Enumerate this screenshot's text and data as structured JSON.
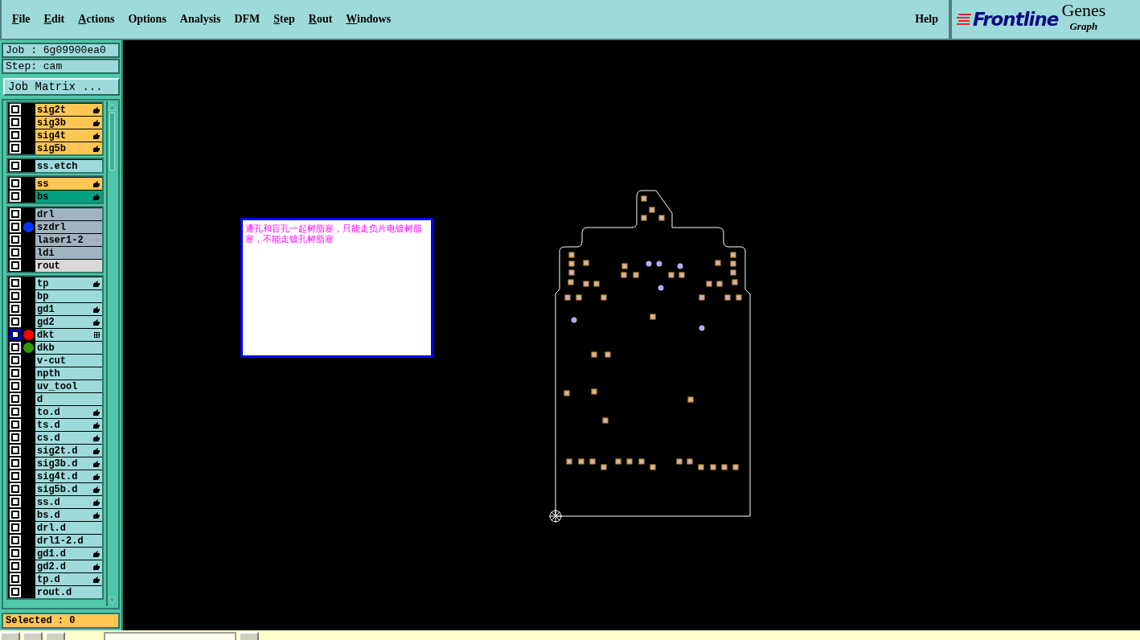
{
  "menu_bar": {
    "items": [
      {
        "label": "File",
        "underlined": true
      },
      {
        "label": "Edit",
        "underlined": true
      },
      {
        "label": "Actions",
        "underlined": true
      },
      {
        "label": "Options",
        "underlined": false
      },
      {
        "label": "Analysis",
        "underlined": false
      },
      {
        "label": "DFM",
        "underlined": false
      },
      {
        "label": "Step",
        "underlined": true
      },
      {
        "label": "Rout",
        "underlined": true
      },
      {
        "label": "Windows",
        "underlined": true
      }
    ],
    "help": "Help"
  },
  "logo": {
    "brand": "Frontline",
    "product": "Genes",
    "subtitle": "Graph"
  },
  "job_panel": {
    "job": "Job : 6g09900ea0",
    "step": "Step: cam",
    "job_matrix_button": "Job Matrix ...",
    "layer_groups": [
      [
        {
          "name": "sig2t",
          "kind": "signal",
          "modified": true,
          "focused": false
        },
        {
          "name": "sig3b",
          "kind": "signal",
          "modified": true,
          "focused": false
        },
        {
          "name": "sig4t",
          "kind": "signal",
          "modified": true,
          "focused": false
        },
        {
          "name": "sig5b",
          "kind": "signal",
          "modified": true,
          "focused": false
        }
      ],
      [
        {
          "name": "ss.etch",
          "kind": "document",
          "modified": false,
          "focused": false
        }
      ],
      [
        {
          "name": "ss",
          "kind": "signal",
          "modified": true,
          "focused": false
        },
        {
          "name": "bs",
          "kind": "solder",
          "modified": true,
          "focused": false
        }
      ],
      [
        {
          "name": "drl",
          "kind": "drill",
          "modified": false,
          "focused": false
        },
        {
          "name": "szdrl",
          "kind": "drill",
          "color": "#0033ff",
          "modified": false,
          "focused": false
        },
        {
          "name": "laser1-2",
          "kind": "drill",
          "modified": false,
          "focused": false
        },
        {
          "name": "ldi",
          "kind": "drill",
          "modified": false,
          "focused": false
        },
        {
          "name": "rout",
          "kind": "rout",
          "modified": false,
          "focused": false
        }
      ],
      [
        {
          "name": "tp",
          "kind": "document",
          "modified": true,
          "focused": false
        },
        {
          "name": "bp",
          "kind": "document",
          "modified": false,
          "focused": false
        },
        {
          "name": "gd1",
          "kind": "document",
          "modified": true,
          "focused": false
        },
        {
          "name": "gd2",
          "kind": "document",
          "modified": true,
          "focused": false
        },
        {
          "name": "dkt",
          "kind": "document",
          "modified": false,
          "expandable": true,
          "color": "#ff0000",
          "focused": true
        },
        {
          "name": "dkb",
          "kind": "document",
          "color": "#339900",
          "modified": false,
          "focused": false
        },
        {
          "name": "v-cut",
          "kind": "document",
          "modified": false,
          "focused": false
        },
        {
          "name": "npth",
          "kind": "document",
          "modified": false,
          "focused": false
        },
        {
          "name": "uv_tool",
          "kind": "document",
          "modified": false,
          "focused": false
        },
        {
          "name": "d",
          "kind": "document",
          "modified": false,
          "focused": false
        },
        {
          "name": "to.d",
          "kind": "document",
          "modified": true,
          "focused": false
        },
        {
          "name": "ts.d",
          "kind": "document",
          "modified": true,
          "focused": false
        },
        {
          "name": "cs.d",
          "kind": "document",
          "modified": true,
          "focused": false
        },
        {
          "name": "sig2t.d",
          "kind": "document",
          "modified": true,
          "focused": false
        },
        {
          "name": "sig3b.d",
          "kind": "document",
          "modified": true,
          "focused": false
        },
        {
          "name": "sig4t.d",
          "kind": "document",
          "modified": true,
          "focused": false
        },
        {
          "name": "sig5b.d",
          "kind": "document",
          "modified": true,
          "focused": false
        },
        {
          "name": "ss.d",
          "kind": "document",
          "modified": true,
          "focused": false
        },
        {
          "name": "bs.d",
          "kind": "document",
          "modified": true,
          "focused": false
        },
        {
          "name": "drl.d",
          "kind": "document",
          "modified": false,
          "focused": false
        },
        {
          "name": "drl1-2.d",
          "kind": "document",
          "modified": false,
          "focused": false
        },
        {
          "name": "gd1.d",
          "kind": "document",
          "modified": true,
          "focused": false
        },
        {
          "name": "gd2.d",
          "kind": "document",
          "modified": true,
          "focused": false
        },
        {
          "name": "tp.d",
          "kind": "document",
          "modified": true,
          "focused": false
        },
        {
          "name": "rout.d",
          "kind": "document",
          "modified": false,
          "focused": false
        }
      ]
    ],
    "selected_label": "Selected : 0"
  },
  "note": {
    "text": "通孔和盲孔一起树脂塞，只能走负片电镀树脂塞，不能走镀孔树脂塞"
  }
}
